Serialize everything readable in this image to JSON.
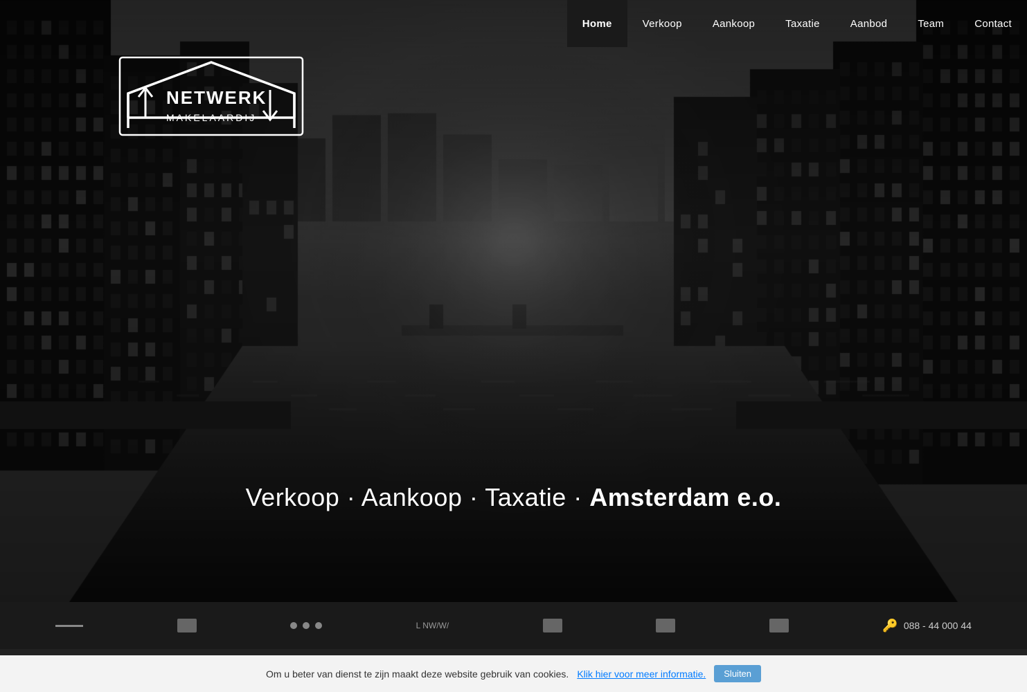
{
  "nav": {
    "items": [
      {
        "label": "Home",
        "active": true
      },
      {
        "label": "Verkoop",
        "active": false
      },
      {
        "label": "Aankoop",
        "active": false
      },
      {
        "label": "Taxatie",
        "active": false
      },
      {
        "label": "Aanbod",
        "active": false
      },
      {
        "label": "Team",
        "active": false
      },
      {
        "label": "Contact",
        "active": false
      }
    ]
  },
  "logo": {
    "line1": "NETWERK",
    "line2": "MAKELAARDIJ"
  },
  "hero": {
    "tagline": "Verkoop · Aankoop · Taxatie · ",
    "tagline_bold": "Amsterdam e.o."
  },
  "bottom_bar": {
    "phone": "088 - 44 000 44",
    "items": [
      "—",
      "🏠",
      "···",
      "L NW/W/",
      "🏠",
      "🏠",
      "🏠",
      "🔑",
      "088 - 44 000 44"
    ]
  },
  "cookie": {
    "text": "Om u beter van dienst te zijn maakt deze website gebruik van cookies.",
    "link_text": "Klik hier voor meer informatie.",
    "button_label": "Sluiten"
  },
  "colors": {
    "nav_active_bg": "#1a1a1a",
    "accent": "#5a9fd4"
  }
}
